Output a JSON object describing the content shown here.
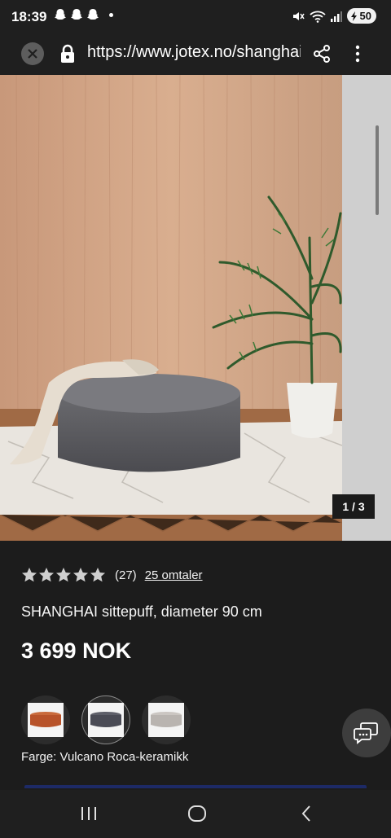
{
  "status_bar": {
    "time": "18:39",
    "battery": "50"
  },
  "browser": {
    "url": "https://www.jotex.no/shanghai"
  },
  "gallery": {
    "counter": "1 / 3"
  },
  "product": {
    "rating_count": "(27)",
    "reviews_link": "25 omtaler",
    "title": "SHANGHAI sittepuff, diameter 90 cm",
    "price": "3 699 NOK",
    "color_label": "Farge: Vulcano Roca-keramikk",
    "swatches": [
      {
        "name": "rust",
        "color": "#b8532a"
      },
      {
        "name": "vulcano-roca",
        "color": "#4a4b55"
      },
      {
        "name": "light-grey",
        "color": "#b9b4b0"
      }
    ]
  },
  "colors": {
    "accent_bar": "#1d2a66"
  }
}
